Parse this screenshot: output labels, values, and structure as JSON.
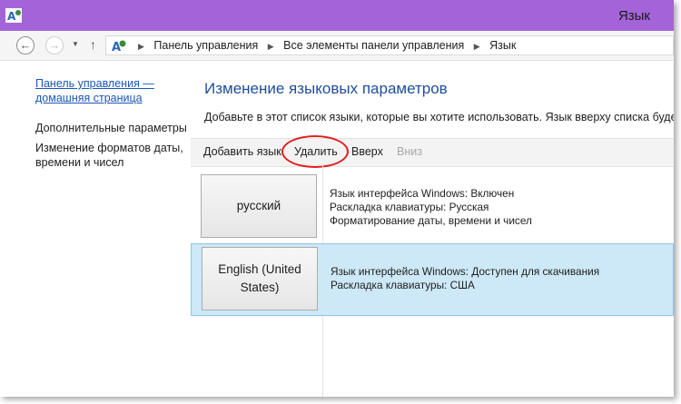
{
  "window": {
    "title": "Язык",
    "titlebar_color": "#a464d9"
  },
  "nav": {
    "back_icon": "arrow-left-icon",
    "forward_icon": "arrow-right-icon",
    "up_icon": "arrow-up-icon"
  },
  "breadcrumb": [
    "Панель управления",
    "Все элементы панели управления",
    "Язык"
  ],
  "sidebar": {
    "home_link": "Панель управления — домашняя страница",
    "items": [
      "Дополнительные параметры",
      "Изменение форматов даты, времени и чисел"
    ]
  },
  "main": {
    "heading": "Изменение языковых параметров",
    "description": "Добавьте в этот список языки, которые вы хотите использовать. Язык вверху списка будет сч",
    "toolbar": {
      "add": "Добавить язык",
      "remove": "Удалить",
      "up": "Вверх",
      "down": "Вниз"
    },
    "languages": [
      {
        "name": "русский",
        "details": [
          "Язык интерфейса Windows: Включен",
          "Раскладка клавиатуры: Русская",
          "Форматирование даты, времени и чисел"
        ],
        "selected": false
      },
      {
        "name": "English (United States)",
        "details": [
          "Язык интерфейса Windows: Доступен для скачивания",
          "Раскладка клавиатуры: США"
        ],
        "selected": true
      }
    ]
  },
  "colors": {
    "link": "#1a56b8",
    "heading": "#1e4d9c",
    "selected_row": "#cde8f6",
    "highlight_oval": "#e01e1e"
  }
}
